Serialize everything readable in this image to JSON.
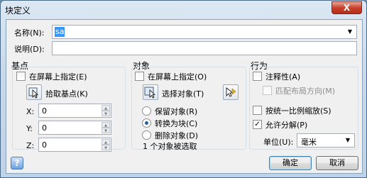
{
  "window": {
    "title": "块定义",
    "close_glyph": "X"
  },
  "name_row": {
    "label": "名称(N):",
    "value": "sa"
  },
  "desc_row": {
    "label": "说明(D):",
    "value": ""
  },
  "basepoint": {
    "title": "基点",
    "specify_on_screen": "在屏幕上指定(E)",
    "pick_label": "拾取基点(K)",
    "x_label": "X:",
    "x_value": "0",
    "y_label": "Y:",
    "y_value": "0",
    "z_label": "Z:",
    "z_value": "0"
  },
  "objects": {
    "title": "对象",
    "specify_on_screen": "在屏幕上指定(O)",
    "select_label": "选择对象(T)",
    "retain": "保留对象(R)",
    "convert": "转换为块(C)",
    "delete": "删除对象(D)",
    "status": "1 个对象被选取"
  },
  "behavior": {
    "title": "行为",
    "annotative": "注释性(A)",
    "match_orientation": "匹配布局方向(M)",
    "scale_uniformly": "按统一比例缩放(S)",
    "allow_exploding": "允许分解(P)",
    "allow_exploding_checked": true,
    "unit_label": "单位(U):",
    "unit_value": "毫米"
  },
  "buttons": {
    "ok": "确定",
    "cancel": "取消",
    "help": "?"
  },
  "colors": {
    "selection": "#3399ff",
    "titlebar": "#c9d9ea",
    "close": "#c9412b"
  }
}
